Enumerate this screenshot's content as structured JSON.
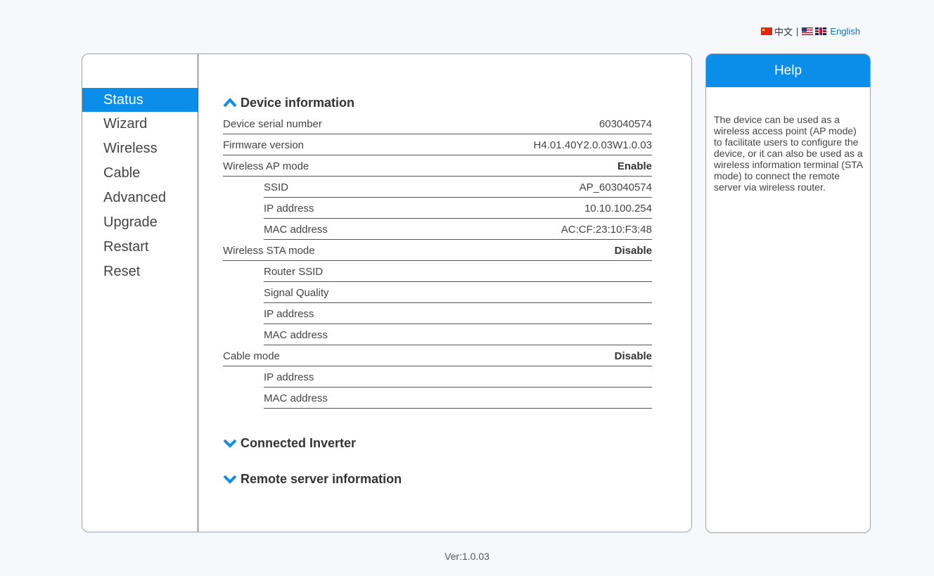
{
  "language_bar": {
    "chinese_label": "中文",
    "separator": "|",
    "english_label": "English"
  },
  "nav": {
    "items": [
      {
        "label": "Status",
        "active": true
      },
      {
        "label": "Wizard",
        "active": false
      },
      {
        "label": "Wireless",
        "active": false
      },
      {
        "label": "Cable",
        "active": false
      },
      {
        "label": "Advanced",
        "active": false
      },
      {
        "label": "Upgrade",
        "active": false
      },
      {
        "label": "Restart",
        "active": false
      },
      {
        "label": "Reset",
        "active": false
      }
    ]
  },
  "device_info": {
    "title": "Device information",
    "expanded": true,
    "rows": {
      "serial": {
        "label": "Device serial number",
        "value": "603040574"
      },
      "firmware": {
        "label": "Firmware version",
        "value": "H4.01.40Y2.0.03W1.0.03"
      },
      "ap_mode": {
        "label": "Wireless AP mode",
        "value": "Enable"
      },
      "ap_ssid": {
        "label": "SSID",
        "value": "AP_603040574"
      },
      "ap_ip": {
        "label": "IP address",
        "value": "10.10.100.254"
      },
      "ap_mac": {
        "label": "MAC address",
        "value": "AC:CF:23:10:F3:48"
      },
      "sta_mode": {
        "label": "Wireless STA mode",
        "value": "Disable"
      },
      "sta_router_ssid": {
        "label": "Router SSID",
        "value": ""
      },
      "sta_signal": {
        "label": "Signal Quality",
        "value": ""
      },
      "sta_ip": {
        "label": "IP address",
        "value": ""
      },
      "sta_mac": {
        "label": "MAC address",
        "value": ""
      },
      "cable_mode": {
        "label": "Cable mode",
        "value": "Disable"
      },
      "cable_ip": {
        "label": "IP address",
        "value": ""
      },
      "cable_mac": {
        "label": "MAC address",
        "value": ""
      }
    }
  },
  "connected_inverter": {
    "title": "Connected Inverter",
    "expanded": false
  },
  "remote_server": {
    "title": "Remote server information",
    "expanded": false
  },
  "help": {
    "title": "Help",
    "text": "The device can be used as a wireless access point (AP mode) to facilitate users to configure the device, or it can also be used as a wireless information terminal (STA mode) to connect the remote server via wireless router."
  },
  "version": "Ver:1.0.03",
  "colors": {
    "accent": "#0a8ee9",
    "link": "#1a6fc4"
  }
}
